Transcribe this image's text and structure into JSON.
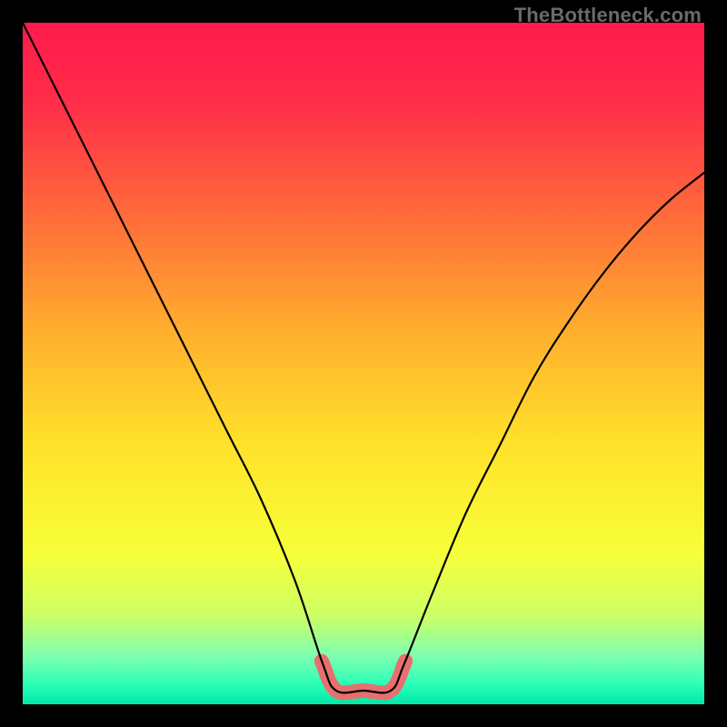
{
  "attribution": "TheBottleneck.com",
  "colors": {
    "frame": "#000000",
    "curve": "#000000",
    "highlight": "#e76f6f",
    "gradient_stops": [
      {
        "pos": 0.0,
        "color": "#ff1a4b"
      },
      {
        "pos": 0.12,
        "color": "#ff2e4a"
      },
      {
        "pos": 0.28,
        "color": "#ff6a3a"
      },
      {
        "pos": 0.45,
        "color": "#ffae2e"
      },
      {
        "pos": 0.62,
        "color": "#ffe22a"
      },
      {
        "pos": 0.78,
        "color": "#f7ff3a"
      },
      {
        "pos": 0.87,
        "color": "#ccff66"
      },
      {
        "pos": 0.93,
        "color": "#7dffb0"
      },
      {
        "pos": 0.97,
        "color": "#2cffb8"
      },
      {
        "pos": 1.0,
        "color": "#00e8a8"
      }
    ]
  },
  "chart_data": {
    "type": "line",
    "title": "",
    "xlabel": "",
    "ylabel": "",
    "xlim": [
      0,
      100
    ],
    "ylim": [
      0,
      100
    ],
    "series": [
      {
        "name": "bottleneck-curve",
        "x": [
          0,
          5,
          10,
          15,
          20,
          25,
          30,
          35,
          40,
          44,
          46,
          50,
          54,
          56,
          60,
          65,
          70,
          75,
          80,
          85,
          90,
          95,
          100
        ],
        "values": [
          100,
          90,
          80,
          70,
          60,
          50,
          40,
          30,
          18,
          6,
          2,
          2,
          2,
          6,
          16,
          28,
          38,
          48,
          56,
          63,
          69,
          74,
          78
        ]
      }
    ],
    "annotations": [
      {
        "name": "optimal-range",
        "x_range": [
          44,
          56
        ],
        "y": 3
      }
    ]
  }
}
